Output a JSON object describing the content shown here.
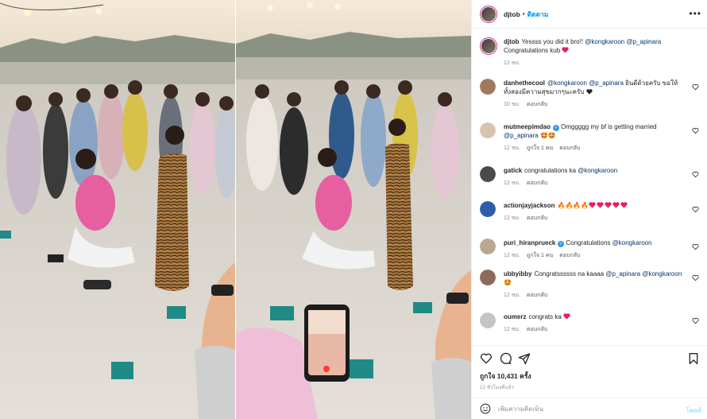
{
  "post": {
    "username": "djtob",
    "follow_label": "ติดตาม",
    "more_label": "•••",
    "caption": {
      "username": "djtob",
      "text_before": "Yessss you did it bro!! ",
      "mention1": "@kongkaroon",
      "mention2": "@p_apinara",
      "text_after": "Congratulations kub",
      "time": "12 ชม."
    },
    "comments": [
      {
        "username": "danhethecool",
        "parts": [
          {
            "t": "mention",
            "v": "@kongkaroon"
          },
          {
            "t": "text",
            "v": " "
          },
          {
            "t": "mention",
            "v": "@p_apinara"
          },
          {
            "t": "text",
            "v": " ยินดีด้วยครับ ขอให้ทั้งสองมีความสุขมากๆนะครับ "
          }
        ],
        "suffix_glyph": "heart-black",
        "time": "10 ชม.",
        "reply": "ตอบกลับ",
        "likes": ""
      },
      {
        "username": "mutmeepimdao",
        "verified": true,
        "parts": [
          {
            "t": "text",
            "v": "Omggggg my bf is getting married "
          },
          {
            "t": "mention",
            "v": "@p_apinara"
          },
          {
            "t": "text",
            "v": " 🤩🤩"
          }
        ],
        "time": "12 ชม.",
        "likes": "ถูกใจ 1 คน",
        "reply": "ตอบกลับ"
      },
      {
        "username": "gatick",
        "parts": [
          {
            "t": "text",
            "v": "congratulations ka "
          },
          {
            "t": "mention",
            "v": "@kongkaroon"
          }
        ],
        "time": "12 ชม.",
        "likes": "",
        "reply": "ตอบกลับ"
      },
      {
        "username": "actionjayjackson",
        "parts": [
          {
            "t": "text",
            "v": "🔥🔥🔥🔥"
          }
        ],
        "hearts": 5,
        "time": "12 ชม.",
        "likes": "",
        "reply": "ตอบกลับ"
      },
      {
        "username": "puri_hiranprueck",
        "verified": true,
        "parts": [
          {
            "t": "text",
            "v": "Congratulations "
          },
          {
            "t": "mention",
            "v": "@kongkaroon"
          }
        ],
        "time": "12 ชม.",
        "likes": "ถูกใจ 1 คน",
        "reply": "ตอบกลับ"
      },
      {
        "username": "ubbyibby",
        "parts": [
          {
            "t": "text",
            "v": "Congratssssss na kaaaa "
          },
          {
            "t": "mention",
            "v": "@p_apinara"
          },
          {
            "t": "text",
            "v": " "
          },
          {
            "t": "mention",
            "v": "@kongkaroon"
          },
          {
            "t": "text",
            "v": " 🤩"
          }
        ],
        "time": "12 ชม.",
        "likes": "",
        "reply": "ตอบกลับ"
      },
      {
        "username": "oumerz",
        "parts": [
          {
            "t": "text",
            "v": "congrats ka "
          }
        ],
        "hearts": 1,
        "time": "12 ชม.",
        "likes": "",
        "reply": "ตอบกลับ"
      }
    ],
    "likes_text": "ถูกใจ 10,431 ครั้ง",
    "posted_ago": "12 ชั่วโมงที่แล้ว",
    "add_comment_placeholder": "เพิ่มความคิดเห็น",
    "post_label": "โพสต์"
  },
  "icons": {
    "like": "heart-outline-icon",
    "comment": "comment-icon",
    "share": "share-icon",
    "save": "bookmark-icon",
    "emoji": "emoji-icon",
    "comment_like": "heart-small-icon"
  },
  "colors": {
    "accent": "#0095f6",
    "heart_red": "#ed4956",
    "mention": "#00376b",
    "muted": "#8e8e8e"
  }
}
